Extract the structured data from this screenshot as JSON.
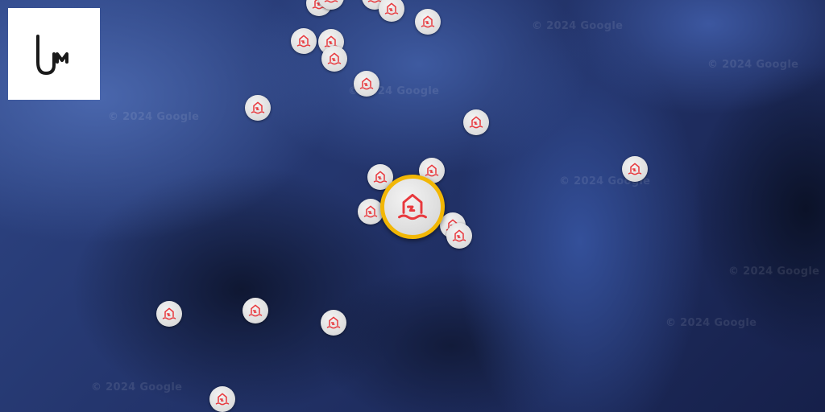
{
  "map": {
    "watermark_text": "© 2024 Google",
    "marker_icon": "flood-house-icon",
    "marker_color": "#e8383d",
    "selected_ring_color": "#f2b705"
  },
  "logo": {
    "text": "UM",
    "icon": "um-logo"
  }
}
